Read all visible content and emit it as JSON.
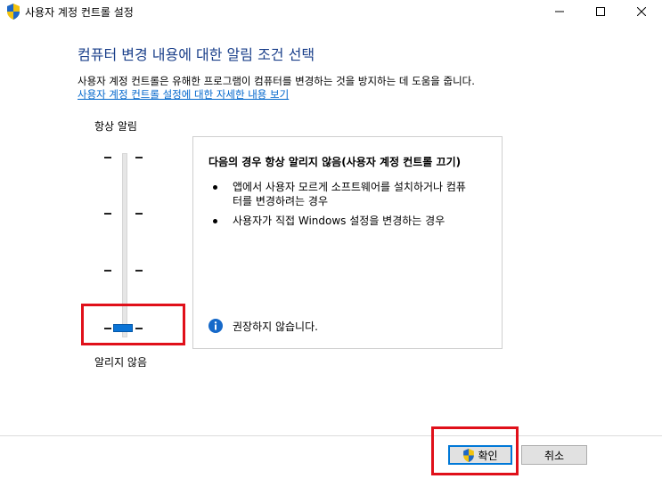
{
  "window": {
    "title": "사용자 계정 컨트롤 설정",
    "icon": "uac-shield-icon",
    "controls": [
      "minimize-icon",
      "maximize-icon",
      "close-icon"
    ]
  },
  "header": {
    "heading": "컴퓨터 변경 내용에 대한 알림 조건 선택",
    "description": "사용자 계정 컨트롤은 유해한 프로그램이 컴퓨터를 변경하는 것을 방지하는 데 도움을 줍니다.",
    "link": "사용자 계정 컨트롤 설정에 대한 자세한 내용 보기"
  },
  "slider": {
    "top_label": "항상 알림",
    "bottom_label": "알리지 않음",
    "levels": 4,
    "selected_level": 1,
    "thumb_color": "#0a74d6"
  },
  "panel": {
    "title": "다음의 경우 항상 알리지 않음(사용자 계정 컨트롤 끄기)",
    "items": [
      {
        "line1": "앱에서 사용자 모르게 소프트웨어를 설치하거나 컴퓨",
        "line2": "터를 변경하려는 경우"
      },
      {
        "line1": "사용자가 직접 Windows 설정을 변경하는 경우",
        "line2": ""
      }
    ],
    "note_icon": "info-icon",
    "note": "권장하지 않습니다."
  },
  "buttons": {
    "ok": "확인",
    "cancel": "취소"
  },
  "colors": {
    "heading": "#1a3f8a",
    "link": "#0066cc",
    "highlight": "#e0101a",
    "accent": "#0078d7"
  }
}
